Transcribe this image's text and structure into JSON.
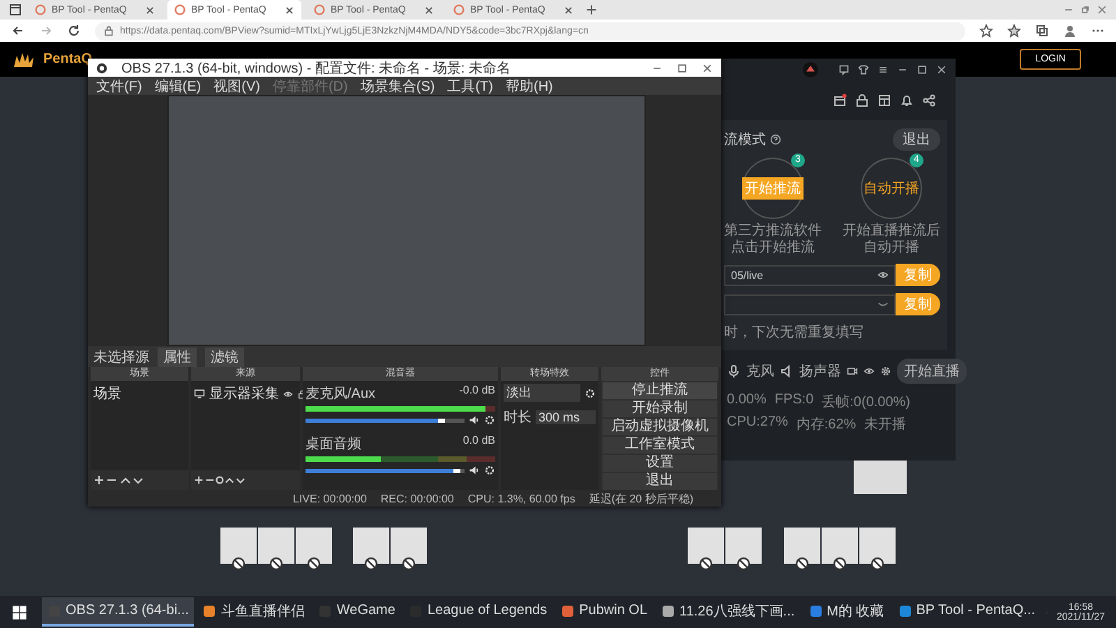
{
  "browser": {
    "tabs": [
      {
        "title": "BP Tool - PentaQ",
        "selected": false
      },
      {
        "title": "BP Tool - PentaQ",
        "selected": true
      },
      {
        "title": "BP Tool - PentaQ",
        "selected": false
      },
      {
        "title": "BP Tool - PentaQ",
        "selected": false
      }
    ],
    "url": "https://data.pentaq.com/BPView?sumid=MTIxLjYwLjg5LjE3NzkzNjM4MDA/NDY5&code=3bc7RXpj&lang=cn"
  },
  "site": {
    "logo": "PentaQ",
    "login": "LOGIN"
  },
  "obs": {
    "title": "OBS 27.1.3 (64-bit, windows) - 配置文件: 未命名 - 场景: 未命名",
    "menu": [
      {
        "label": "文件(F)",
        "disabled": false
      },
      {
        "label": "编辑(E)",
        "disabled": false
      },
      {
        "label": "视图(V)",
        "disabled": false
      },
      {
        "label": "停靠部件(D)",
        "disabled": true
      },
      {
        "label": "场景集合(S)",
        "disabled": false
      },
      {
        "label": "工具(T)",
        "disabled": false
      },
      {
        "label": "帮助(H)",
        "disabled": false
      }
    ],
    "source_bar": {
      "label": "未选择源",
      "buttons": [
        "属性",
        "滤镜"
      ]
    },
    "scenes": {
      "title": "场景",
      "items": [
        {
          "name": "场景",
          "selected": false
        }
      ]
    },
    "sources": {
      "title": "来源",
      "items": [
        {
          "name": "显示器采集"
        }
      ]
    },
    "mixer": {
      "title": "混音器",
      "channels": [
        {
          "name": "麦克风/Aux",
          "reading": "-0.0 dB",
          "level": 0.88,
          "meter": {
            "level": 0.95
          }
        },
        {
          "name": "桌面音频",
          "reading": "0.0 dB",
          "level": 0.97,
          "meter": {
            "level": 0.4
          }
        }
      ]
    },
    "transitions": {
      "title": "转场特效",
      "type": "淡出",
      "duration_label": "时长",
      "duration": "300 ms"
    },
    "controls": {
      "title": "控件",
      "buttons": [
        {
          "label": "停止推流",
          "kind": "dropdown"
        },
        {
          "label": "开始录制",
          "kind": "button"
        },
        {
          "label": "启动虚拟摄像机",
          "kind": "button"
        },
        {
          "label": "工作室模式",
          "kind": "button"
        },
        {
          "label": "设置",
          "kind": "button"
        },
        {
          "label": "退出",
          "kind": "button"
        }
      ]
    },
    "status_bar": [
      "LIVE: 00:00:00",
      "REC: 00:00:00",
      "CPU: 1.3%, 60.00 fps",
      "延迟(在 20 秒后平稳)"
    ]
  },
  "helper": {
    "mode": "流模式",
    "exit": "退出",
    "steps": [
      {
        "badge": "3",
        "label": "开始推流",
        "kind": "button",
        "caption": [
          "第三方推流软件",
          "点击开始推流"
        ]
      },
      {
        "badge": "4",
        "label": "自动开播",
        "kind": "text",
        "caption": [
          "开始直播推流后",
          "自动开播"
        ]
      }
    ],
    "fields": [
      {
        "value": "05/live",
        "kind": "visible",
        "button": "复制"
      },
      {
        "kind": "hidden",
        "button": "复制"
      }
    ],
    "note": "时，下次无需重复填写",
    "devices": [
      "克风",
      "扬声器"
    ],
    "start": "开始直播",
    "stats": [
      "0.00%",
      "FPS:0",
      "丢帧:0(0.00%)",
      "CPU:27%",
      "内存:62%",
      "未开播"
    ]
  },
  "taskbar": {
    "items": [
      {
        "label": "OBS 27.1.3 (64-bi...",
        "selected": true
      },
      {
        "label": "斗鱼直播伴侣",
        "selected": false
      },
      {
        "label": "WeGame",
        "selected": false
      },
      {
        "label": "League of Legends",
        "selected": false
      },
      {
        "label": "Pubwin OL",
        "selected": false
      },
      {
        "label": "11.26八强线下画...",
        "selected": false
      },
      {
        "label": "M的 收藏",
        "selected": false
      },
      {
        "label": "BP Tool - PentaQ...",
        "selected": false
      }
    ],
    "time": "16:58",
    "date": "2021/11/27"
  }
}
